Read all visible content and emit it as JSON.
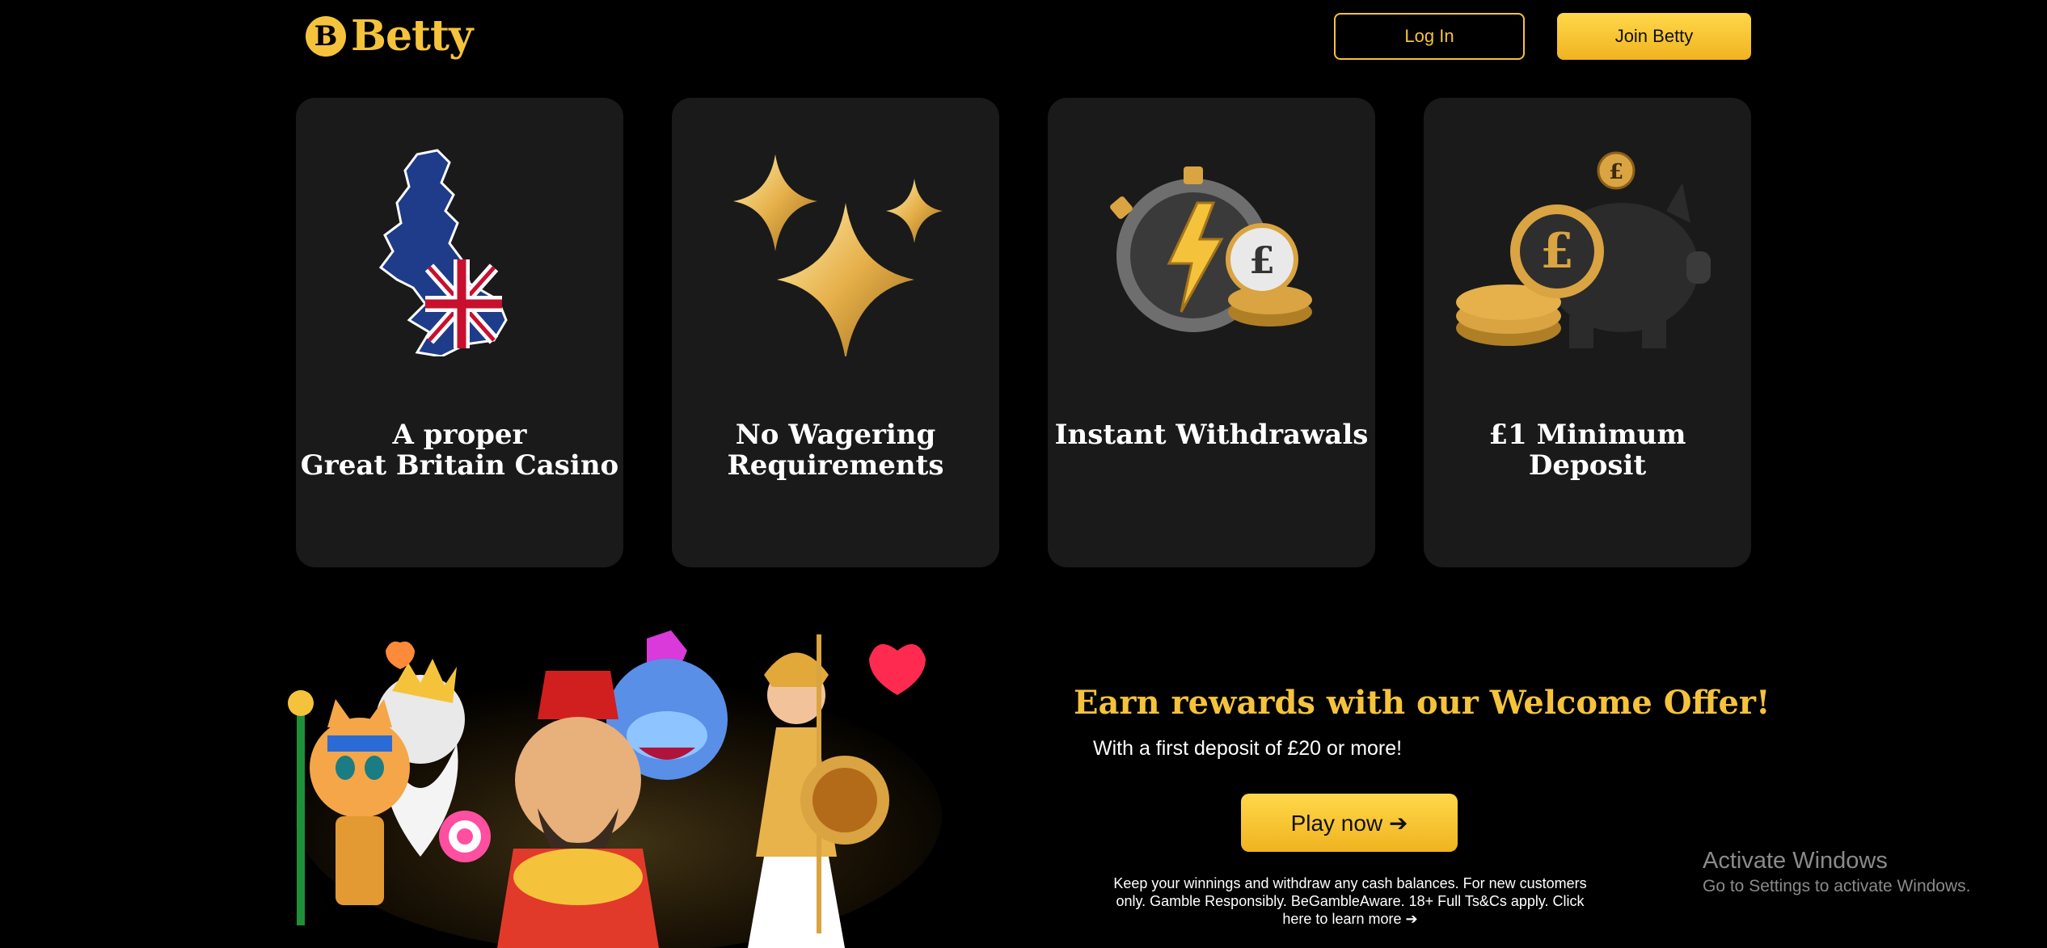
{
  "header": {
    "logo_text": "Betty",
    "logo_letter": "B",
    "login_label": "Log In",
    "join_label": "Join Betty"
  },
  "features": [
    {
      "title": "A proper\nGreat Britain Casino",
      "icon": "uk-map-icon"
    },
    {
      "title": "No Wagering\nRequirements",
      "icon": "sparkles-icon"
    },
    {
      "title": "Instant Withdrawals",
      "icon": "stopwatch-coin-icon"
    },
    {
      "title": "£1 Minimum\nDeposit",
      "icon": "piggy-bank-icon"
    }
  ],
  "promo": {
    "title": "Earn rewards with our Welcome Offer!",
    "subtitle": "With a first deposit of £20 or more!",
    "play_label": "Play now ➔",
    "legal": "Keep your winnings and withdraw any cash balances. For new customers only. Gamble Responsibly. BeGambleAware. 18+ Full Ts&Cs apply. Click here to learn more ➔"
  },
  "os_notice": {
    "title": "Activate Windows",
    "subtitle": "Go to Settings to activate Windows."
  },
  "colors": {
    "background": "#000000",
    "card": "#1a1a1a",
    "gold": "#f5c33b"
  }
}
